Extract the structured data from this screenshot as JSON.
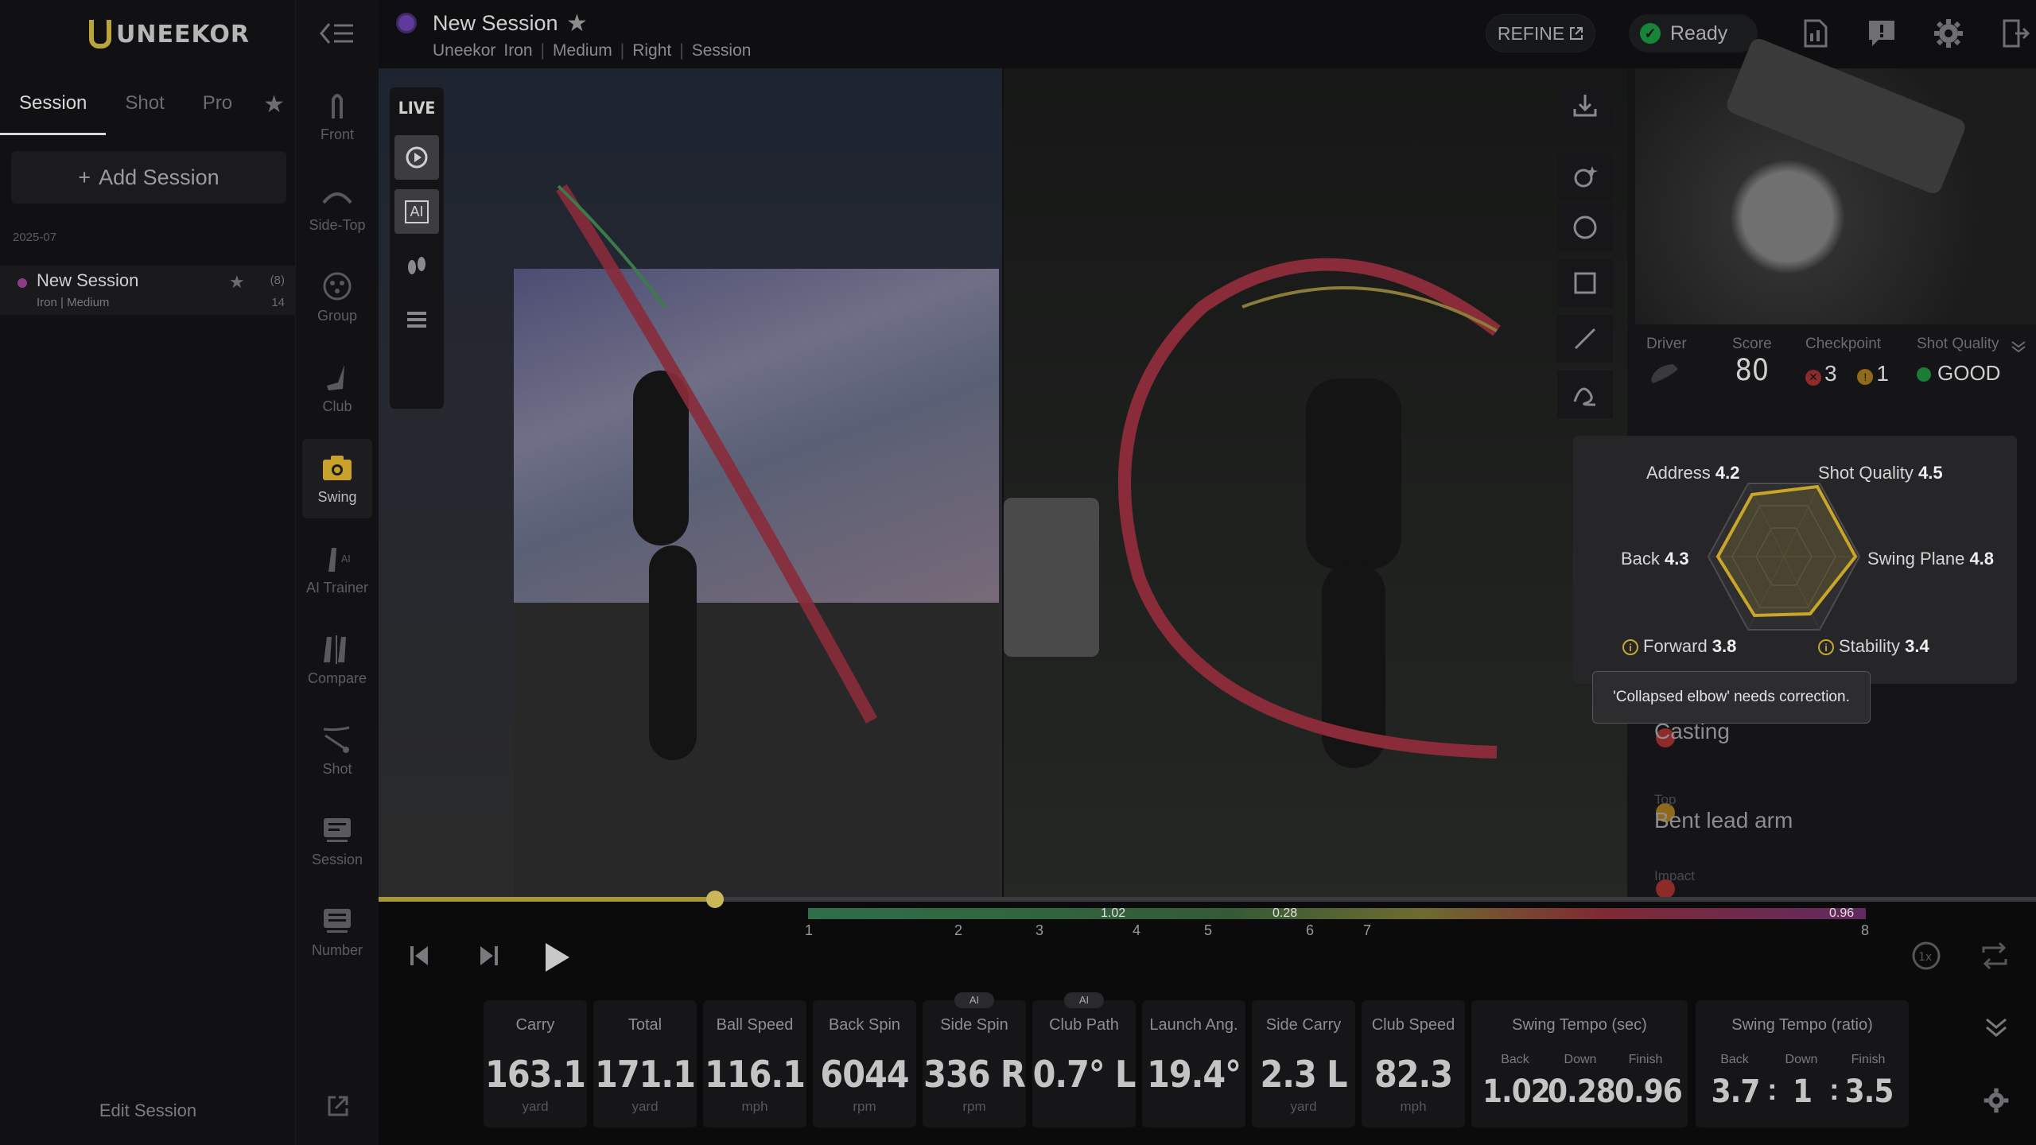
{
  "app": {
    "logo_text": "UNEEKOR"
  },
  "left_panel": {
    "tabs": [
      "Session",
      "Shot",
      "Pro"
    ],
    "add_session_label": "Add Session",
    "date_header": "2025-07",
    "session": {
      "name": "New Session",
      "sub": "Iron | Medium",
      "count_top": "(8)",
      "count_bottom": "14"
    },
    "edit_session_label": "Edit Session"
  },
  "rail": {
    "items": [
      {
        "label": "Front",
        "icon": "front-view-icon"
      },
      {
        "label": "Side-Top",
        "icon": "side-top-view-icon"
      },
      {
        "label": "Group",
        "icon": "group-icon"
      },
      {
        "label": "Club",
        "icon": "club-icon"
      },
      {
        "label": "Swing",
        "icon": "camera-icon"
      },
      {
        "label": "AI Trainer",
        "icon": "ai-trainer-icon"
      },
      {
        "label": "Compare",
        "icon": "compare-icon"
      },
      {
        "label": "Shot",
        "icon": "shot-icon"
      },
      {
        "label": "Session",
        "icon": "session-icon"
      },
      {
        "label": "Number",
        "icon": "number-icon"
      }
    ]
  },
  "topbar": {
    "title": "New Session",
    "breadcrumb": [
      "Uneekor",
      "Iron",
      "Medium",
      "Right",
      "Session"
    ],
    "refine_label": "REFINE",
    "status_label": "Ready"
  },
  "video": {
    "live_label": "LIVE",
    "ai_label": "AI"
  },
  "right_panel": {
    "driver_label": "Driver",
    "score_label": "Score",
    "score_value": "80",
    "checkpoint_label": "Checkpoint",
    "checkpoint_fail": "3",
    "checkpoint_warn": "1",
    "shot_quality_label": "Shot Quality",
    "shot_quality_value": "GOOD",
    "radar": {
      "address": {
        "label": "Address",
        "value": "4.2"
      },
      "shot_quality": {
        "label": "Shot Quality",
        "value": "4.5"
      },
      "back": {
        "label": "Back",
        "value": "4.3"
      },
      "swing_plane": {
        "label": "Swing Plane",
        "value": "4.8"
      },
      "forward": {
        "label": "Forward",
        "value": "3.8"
      },
      "stability": {
        "label": "Stability",
        "value": "3.4"
      }
    },
    "tooltip": "'Collapsed elbow' needs correction.",
    "issues": [
      {
        "position": "",
        "name": "Casting",
        "severity": "fail"
      },
      {
        "position": "Top",
        "name": "Bent lead arm",
        "severity": "warn"
      },
      {
        "position": "Impact",
        "name": "",
        "severity": "fail"
      }
    ]
  },
  "timeline": {
    "phases": [
      "1",
      "2",
      "3",
      "4",
      "5",
      "6",
      "7",
      "8"
    ],
    "times": [
      "1.02",
      "0.28",
      "0.96"
    ]
  },
  "metrics": [
    {
      "label": "Carry",
      "value": "163.1",
      "unit": "yard",
      "ai": ""
    },
    {
      "label": "Total",
      "value": "171.1",
      "unit": "yard",
      "ai": ""
    },
    {
      "label": "Ball Speed",
      "value": "116.1",
      "unit": "mph",
      "ai": ""
    },
    {
      "label": "Back Spin",
      "value": "6044",
      "unit": "rpm",
      "ai": ""
    },
    {
      "label": "Side Spin",
      "value": "336 R",
      "unit": "rpm",
      "ai": "AI"
    },
    {
      "label": "Club Path",
      "value": "0.7° L",
      "unit": "",
      "ai": "AI"
    },
    {
      "label": "Launch Ang.",
      "value": "19.4°",
      "unit": "",
      "ai": ""
    },
    {
      "label": "Side Carry",
      "value": "2.3 L",
      "unit": "yard",
      "ai": ""
    },
    {
      "label": "Club Speed",
      "value": "82.3",
      "unit": "mph",
      "ai": ""
    }
  ],
  "tempo_sec": {
    "label": "Swing Tempo (sec)",
    "subs": [
      "Back",
      "Down",
      "Finish"
    ],
    "values": [
      "1.02",
      "0.28",
      "0.96"
    ]
  },
  "tempo_ratio": {
    "label": "Swing Tempo (ratio)",
    "subs": [
      "Back",
      "Down",
      "Finish"
    ],
    "values": [
      "3.7",
      "1",
      "3.5"
    ],
    "separator": ":"
  }
}
